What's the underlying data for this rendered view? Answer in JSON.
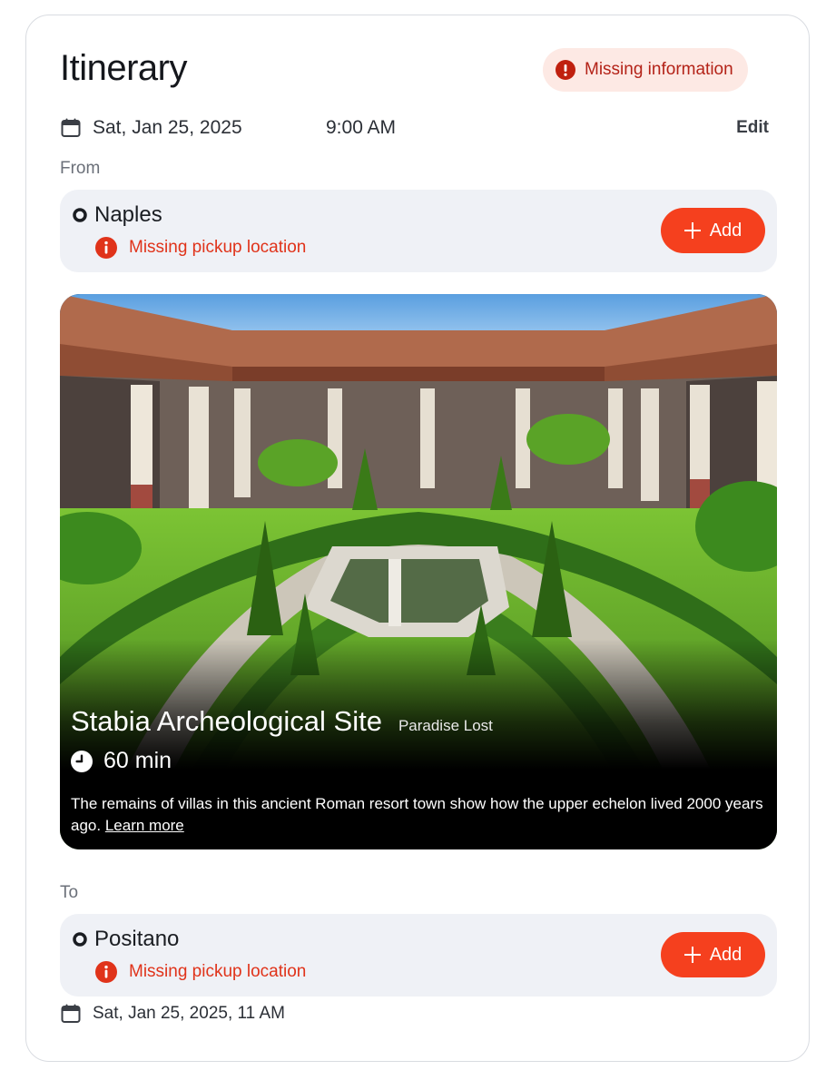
{
  "itinerary": {
    "title": "Itinerary",
    "status_badge": "Missing information",
    "date": "Sat, Jan 25, 2025",
    "time": "9:00 AM",
    "edit_label": "Edit",
    "from_label": "From",
    "to_label": "To"
  },
  "origin": {
    "name": "Naples",
    "warning": "Missing pickup location",
    "add_label": "Add"
  },
  "stop": {
    "title": "Stabia Archeological Site",
    "subtitle": "Paradise Lost",
    "duration": "60 min",
    "description": "The remains of villas in this ancient Roman resort town show how the upper echelon lived 2000 years ago.",
    "learn_more": "Learn more"
  },
  "destination": {
    "name": "Positano",
    "warning": "Missing pickup location",
    "add_label": "Add",
    "arrival": "Sat, Jan 25, 2025, 11 AM"
  },
  "icons": {
    "status": "alert-circle-icon",
    "date": "calendar-icon",
    "location": "location-dot-icon",
    "warning": "info-icon",
    "add": "plus-icon",
    "duration": "clock-icon"
  },
  "colors": {
    "accent": "#f5401e",
    "warning_text": "#e0331a",
    "badge_bg": "#fde9e4",
    "badge_text": "#b42318",
    "location_bg": "#eff1f6"
  }
}
